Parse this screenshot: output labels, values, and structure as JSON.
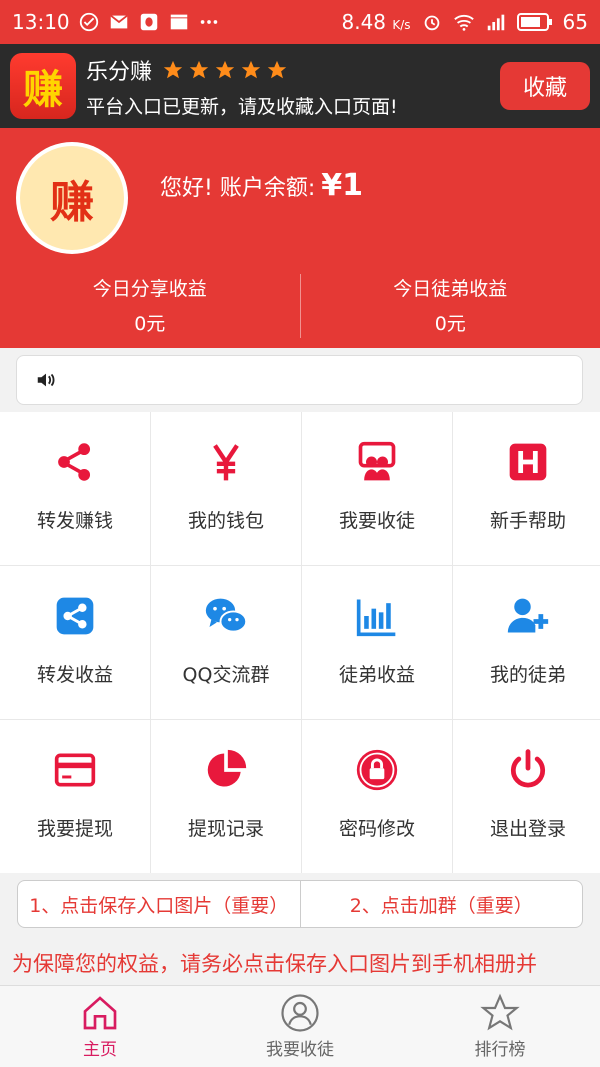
{
  "status_bar": {
    "time": "13:10",
    "net_speed": "8.48",
    "net_unit": "K/s",
    "battery": "65"
  },
  "banner": {
    "logo_text": "赚",
    "app_name": "乐分赚",
    "rating_stars": 5,
    "message": "平台入口已更新，请及收藏入口页面!",
    "collect_label": "收藏"
  },
  "header": {
    "avatar_text": "赚",
    "greeting": "您好! 账户余额:",
    "balance": "¥1",
    "today_share_label": "今日分享收益",
    "today_share_value": "0元",
    "today_apprentice_label": "今日徒弟收益",
    "today_apprentice_value": "0元"
  },
  "notice": {
    "icon": "speaker-icon"
  },
  "grid": [
    {
      "label": "转发赚钱",
      "icon": "share-icon",
      "color": "#e8183c"
    },
    {
      "label": "我的钱包",
      "icon": "yuan-icon",
      "color": "#e8183c"
    },
    {
      "label": "我要收徒",
      "icon": "recruit-icon",
      "color": "#e8183c"
    },
    {
      "label": "新手帮助",
      "icon": "help-icon",
      "color": "#e8183c"
    },
    {
      "label": "转发收益",
      "icon": "share-square-icon",
      "color": "#1e88e5"
    },
    {
      "label": "QQ交流群",
      "icon": "chat-icon",
      "color": "#1e88e5"
    },
    {
      "label": "徒弟收益",
      "icon": "bar-chart-icon",
      "color": "#1e88e5"
    },
    {
      "label": "我的徒弟",
      "icon": "add-user-icon",
      "color": "#1e88e5"
    },
    {
      "label": "我要提现",
      "icon": "card-icon",
      "color": "#e8183c"
    },
    {
      "label": "提现记录",
      "icon": "pie-icon",
      "color": "#e8183c"
    },
    {
      "label": "密码修改",
      "icon": "lock-icon",
      "color": "#e8183c"
    },
    {
      "label": "退出登录",
      "icon": "power-icon",
      "color": "#e8183c"
    }
  ],
  "actions": {
    "save_image": "1、点击保存入口图片（重要）",
    "join_group": "2、点击加群（重要）"
  },
  "warning": "为保障您的权益，请务必点击保存入口图片到手机相册并",
  "bottom_nav": [
    {
      "label": "主页",
      "icon": "home-icon",
      "active": true
    },
    {
      "label": "我要收徒",
      "icon": "person-icon",
      "active": false
    },
    {
      "label": "排行榜",
      "icon": "star-icon",
      "active": false
    }
  ]
}
